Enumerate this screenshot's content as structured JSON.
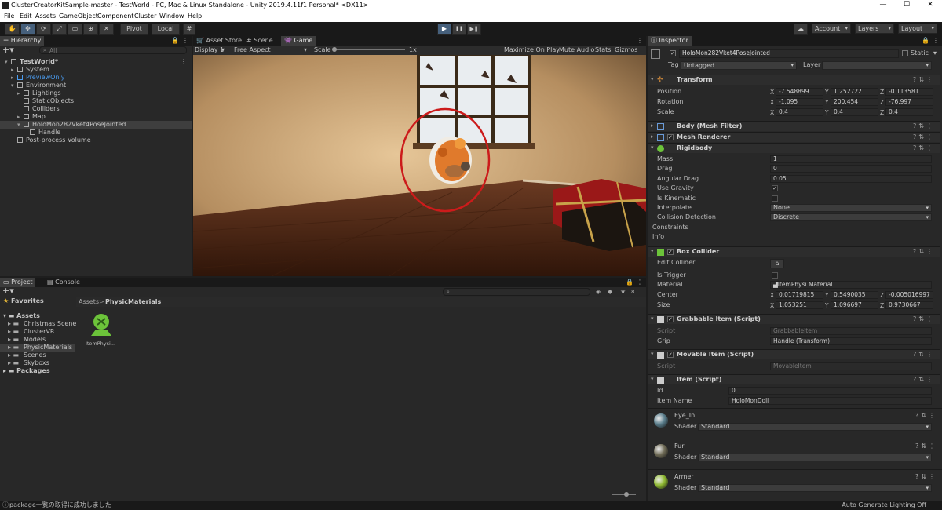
{
  "window": {
    "title": "ClusterCreatorKitSample-master - TestWorld - PC, Mac & Linux Standalone - Unity 2019.4.11f1 Personal* <DX11>",
    "min": "—",
    "max": "☐",
    "close": "✕"
  },
  "menu": [
    "File",
    "Edit",
    "Assets",
    "GameObject",
    "Component",
    "Cluster",
    "Window",
    "Help"
  ],
  "toolbar": {
    "pivot": "Pivot",
    "local": "Local",
    "account": "Account",
    "layers": "Layers",
    "layout": "Layout",
    "play": "▶",
    "pause": "❚❚",
    "step": "▶❚"
  },
  "hierarchy": {
    "tab": "Hierarchy",
    "search_placeholder": "All",
    "items": [
      {
        "label": "TestWorld*",
        "indent": 0,
        "arrow": "▾",
        "bold": true,
        "blue": false
      },
      {
        "label": "System",
        "indent": 1,
        "arrow": "▸",
        "bold": false,
        "blue": false
      },
      {
        "label": "PreviewOnly",
        "indent": 1,
        "arrow": "▸",
        "bold": false,
        "blue": true
      },
      {
        "label": "Environment",
        "indent": 1,
        "arrow": "▾",
        "bold": false,
        "blue": false
      },
      {
        "label": "Lightings",
        "indent": 2,
        "arrow": "▸",
        "bold": false,
        "blue": false
      },
      {
        "label": "StaticObjects",
        "indent": 2,
        "arrow": "",
        "bold": false,
        "blue": false
      },
      {
        "label": "Colliders",
        "indent": 2,
        "arrow": "",
        "bold": false,
        "blue": false
      },
      {
        "label": "Map",
        "indent": 2,
        "arrow": "▸",
        "bold": false,
        "blue": false
      },
      {
        "label": "HoloMon282Vket4PoseJointed",
        "indent": 2,
        "arrow": "▾",
        "bold": false,
        "blue": false,
        "selected": true
      },
      {
        "label": "Handle",
        "indent": 3,
        "arrow": "",
        "bold": false,
        "blue": false
      },
      {
        "label": "Post-process Volume",
        "indent": 1,
        "arrow": "",
        "bold": false,
        "blue": false
      }
    ]
  },
  "game": {
    "tabs": [
      "Asset Store",
      "Scene",
      "Game"
    ],
    "display": "Display 1",
    "aspect": "Free Aspect",
    "scale_label": "Scale",
    "scale_value": "1x",
    "opts": [
      "Maximize On Play",
      "Mute Audio",
      "Stats",
      "Gizmos"
    ]
  },
  "project": {
    "tabs": [
      "Project",
      "Console"
    ],
    "favorites": "Favorites",
    "assets": "Assets",
    "folders": [
      "Christmas Scene",
      "ClusterVR",
      "Models",
      "PhysicMaterials",
      "Scenes",
      "Skyboxs"
    ],
    "packages": "Packages",
    "breadcrumb": [
      "Assets",
      "PhysicMaterials"
    ],
    "asset_item": "ItemPhysi...",
    "count": "8"
  },
  "inspector": {
    "tab": "Inspector",
    "object_name": "HoloMon282Vket4PoseJointed",
    "static_label": "Static",
    "tag_label": "Tag",
    "tag_value": "Untagged",
    "layer_label": "Layer",
    "layer_value": "",
    "transform": {
      "name": "Transform",
      "position": {
        "label": "Position",
        "x": "-7.548899",
        "y": "1.252722",
        "z": "-0.113581"
      },
      "rotation": {
        "label": "Rotation",
        "x": "-1.095",
        "y": "200.454",
        "z": "-76.997"
      },
      "scale": {
        "label": "Scale",
        "x": "0.4",
        "y": "0.4",
        "z": "0.4"
      }
    },
    "mesh_filter": "Body (Mesh Filter)",
    "mesh_renderer": "Mesh Renderer",
    "rigidbody": {
      "name": "Rigidbody",
      "mass_label": "Mass",
      "mass": "1",
      "drag_label": "Drag",
      "drag": "0",
      "angdrag_label": "Angular Drag",
      "angdrag": "0.05",
      "gravity_label": "Use Gravity",
      "gravity": "✓",
      "kinematic_label": "Is Kinematic",
      "interp_label": "Interpolate",
      "interp": "None",
      "coll_label": "Collision Detection",
      "coll": "Discrete",
      "constraints": "Constraints",
      "info": "Info"
    },
    "box_collider": {
      "name": "Box Collider",
      "edit_label": "Edit Collider",
      "trigger_label": "Is Trigger",
      "material_label": "Material",
      "material": "ItemPhysi Material",
      "center_label": "Center",
      "cx": "0.01719815",
      "cy": "0.5490035",
      "cz": "-0.005016997",
      "size_label": "Size",
      "sx": "1.053251",
      "sy": "1.096697",
      "sz": "0.9730667"
    },
    "grabbable": {
      "name": "Grabbable Item (Script)",
      "script_label": "Script",
      "script": "GrabbableItem",
      "grip_label": "Grip",
      "grip": "Handle (Transform)"
    },
    "movable": {
      "name": "Movable Item (Script)",
      "script_label": "Script",
      "script": "MovableItem"
    },
    "item": {
      "name": "Item (Script)",
      "id_label": "Id",
      "id": "0",
      "iname_label": "Item Name",
      "iname": "HoloMonDoll"
    },
    "materials": [
      {
        "name": "Eye_In",
        "shader_label": "Shader",
        "shader": "Standard",
        "color": "#5a7e8c"
      },
      {
        "name": "Fur",
        "shader_label": "Shader",
        "shader": "Standard",
        "color": "#6e6a55"
      },
      {
        "name": "Armer",
        "shader_label": "Shader",
        "shader": "Standard",
        "color": "#8eb830"
      }
    ]
  },
  "status": {
    "left": "package一覧の取得に成功しました",
    "right": "Auto Generate Lighting Off"
  },
  "axes": {
    "x": "X",
    "y": "Y",
    "z": "Z"
  }
}
